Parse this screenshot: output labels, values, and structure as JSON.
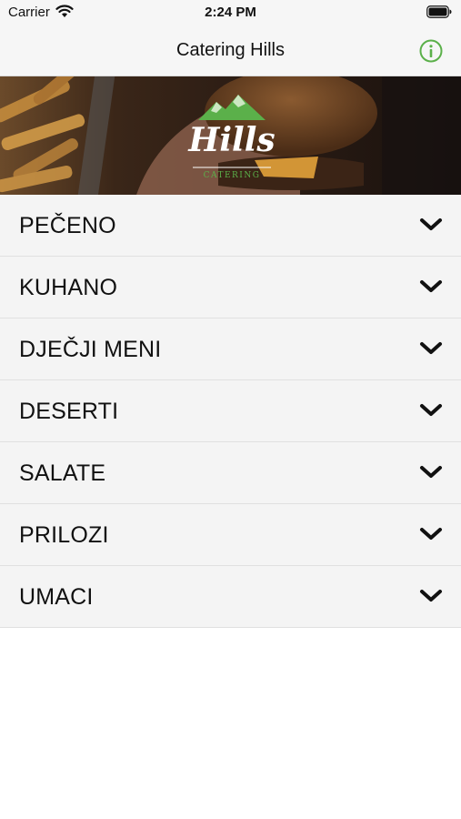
{
  "status_bar": {
    "carrier": "Carrier",
    "time": "2:24 PM"
  },
  "nav": {
    "title": "Catering Hills",
    "info_icon": "info-circle-icon",
    "accent_color": "#5bb04a"
  },
  "hero": {
    "logo_text": "Hills",
    "logo_subtext": "CATERING"
  },
  "menu": {
    "items": [
      {
        "label": "PEČENO"
      },
      {
        "label": "KUHANO"
      },
      {
        "label": "DJEČJI MENI"
      },
      {
        "label": "DESERTI"
      },
      {
        "label": "SALATE"
      },
      {
        "label": "PRILOZI"
      },
      {
        "label": "UMACI"
      }
    ],
    "expand_icon": "chevron-down-icon"
  }
}
